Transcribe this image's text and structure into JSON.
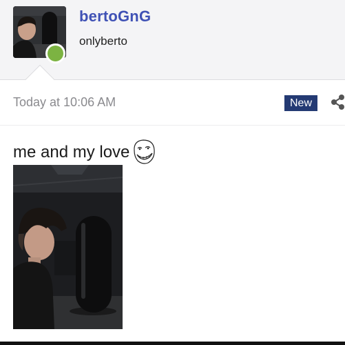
{
  "post": {
    "author": {
      "username": "bertoGnG",
      "user_title": "onlyberto",
      "avatar": "profile-photo",
      "online_status": "online",
      "online_color": "#7cb342"
    },
    "timestamp": "Today at 10:06 AM",
    "badge": "New",
    "share_icon": "share-icon",
    "message": "me and my love",
    "emoji_icon": "trollface-emoji",
    "attachment": "photo-of-boy-with-black-punching-bag"
  },
  "colors": {
    "username": "#3f51b5",
    "badge_bg": "#243a73",
    "header_bg": "#f4f4f6",
    "timestamp": "#8a8a8e"
  }
}
